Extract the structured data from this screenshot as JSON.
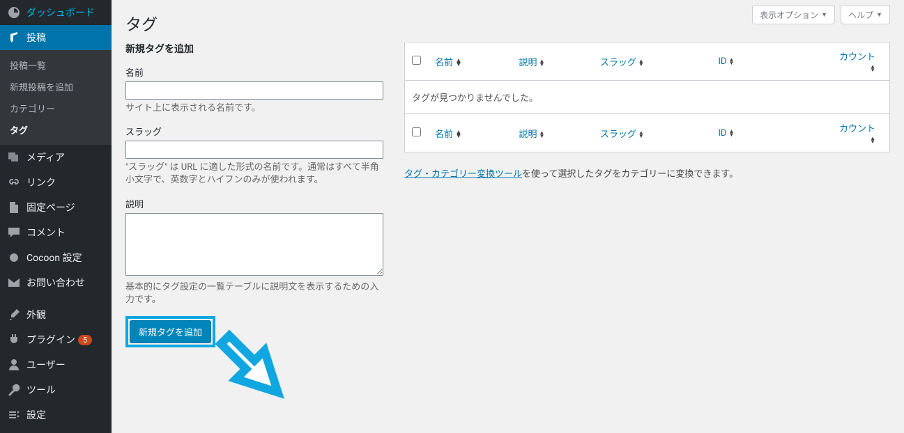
{
  "sidebar": {
    "items": [
      {
        "label": "ダッシュボード",
        "icon": "dashboard"
      },
      {
        "label": "投稿",
        "icon": "pin",
        "current": true,
        "submenu": [
          {
            "label": "投稿一覧"
          },
          {
            "label": "新規投稿を追加"
          },
          {
            "label": "カテゴリー"
          },
          {
            "label": "タグ",
            "active": true
          }
        ]
      },
      {
        "label": "メディア",
        "icon": "media"
      },
      {
        "label": "リンク",
        "icon": "link"
      },
      {
        "label": "固定ページ",
        "icon": "page"
      },
      {
        "label": "コメント",
        "icon": "comment"
      },
      {
        "label": "Cocoon 設定",
        "icon": "circle"
      },
      {
        "label": "お問い合わせ",
        "icon": "mail"
      },
      {
        "label": "外観",
        "icon": "brush"
      },
      {
        "label": "プラグイン",
        "icon": "plug",
        "badge": "5"
      },
      {
        "label": "ユーザー",
        "icon": "user"
      },
      {
        "label": "ツール",
        "icon": "tool"
      },
      {
        "label": "設定",
        "icon": "settings"
      }
    ]
  },
  "screen": {
    "options_label": "表示オプション",
    "help_label": "ヘルプ"
  },
  "page": {
    "title": "タグ",
    "form_heading": "新規タグを追加",
    "fields": {
      "name": {
        "label": "名前",
        "value": "",
        "desc": "サイト上に表示される名前です。"
      },
      "slug": {
        "label": "スラッグ",
        "value": "",
        "desc": "\"スラッグ\" は URL に適した形式の名前です。通常はすべて半角小文字で、英数字とハイフンのみが使われます。"
      },
      "description": {
        "label": "説明",
        "value": "",
        "desc": "基本的にタグ設定の一覧テーブルに説明文を表示するための入力です。"
      }
    },
    "submit_label": "新規タグを追加"
  },
  "table": {
    "columns": {
      "name": "名前",
      "description": "説明",
      "slug": "スラッグ",
      "id": "ID",
      "count": "カウント"
    },
    "empty": "タグが見つかりませんでした。"
  },
  "converter": {
    "link": "タグ・カテゴリー変換ツール",
    "text": "を使って選択したタグをカテゴリーに変換できます。"
  }
}
